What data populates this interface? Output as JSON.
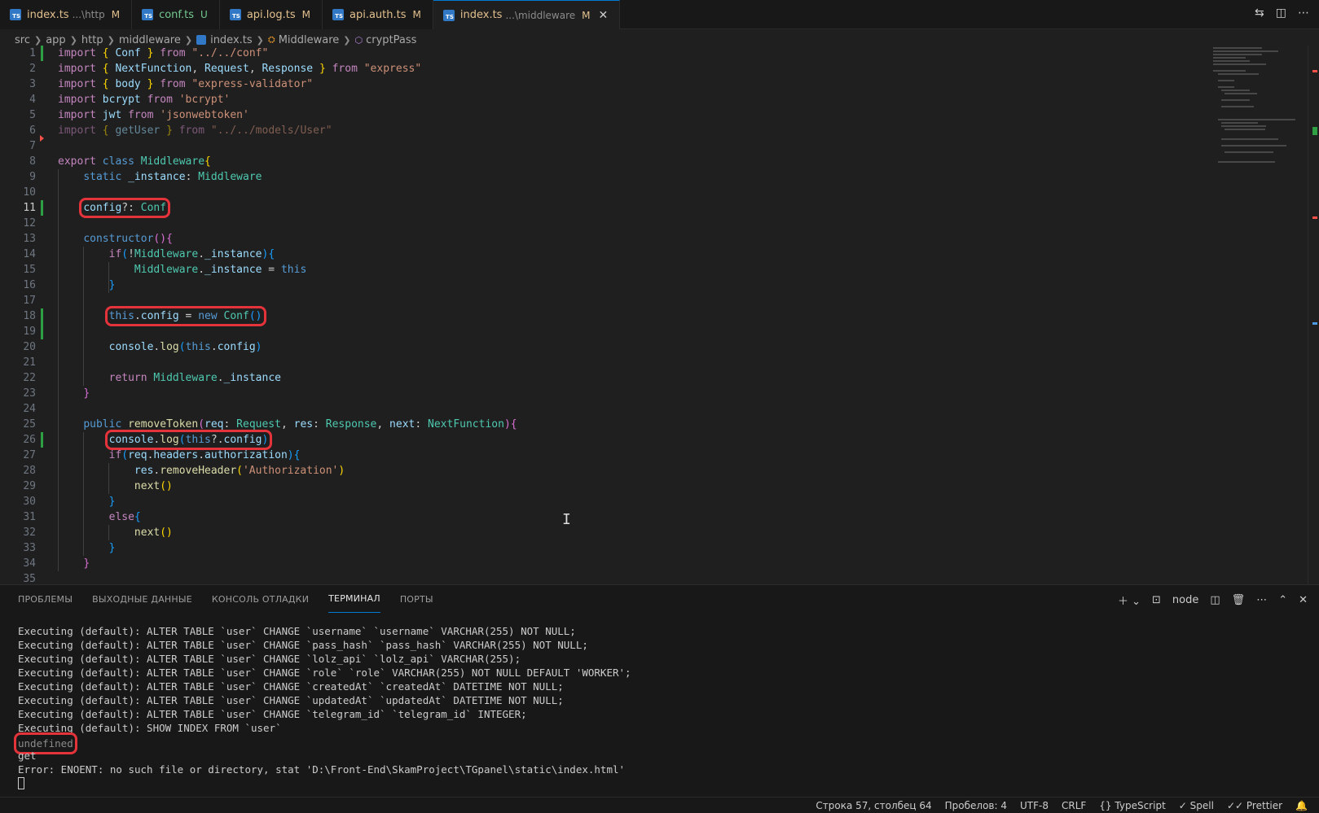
{
  "tabs": [
    {
      "name": "index.ts",
      "path": "...\\http",
      "status": "M"
    },
    {
      "name": "conf.ts",
      "path": "",
      "status": "U"
    },
    {
      "name": "api.log.ts",
      "path": "",
      "status": "M"
    },
    {
      "name": "api.auth.ts",
      "path": "",
      "status": "M"
    },
    {
      "name": "index.ts",
      "path": "...\\middleware",
      "status": "M",
      "close": "✕"
    }
  ],
  "breadcrumb": [
    "src",
    "app",
    "http",
    "middleware",
    "index.ts",
    "Middleware",
    "cryptPass"
  ],
  "editor": {
    "line_numbers": [
      "1",
      "2",
      "3",
      "4",
      "5",
      "6",
      "7",
      "8",
      "9",
      "10",
      "11",
      "12",
      "13",
      "14",
      "15",
      "16",
      "17",
      "18",
      "19",
      "20",
      "21",
      "22",
      "23",
      "24",
      "25",
      "26",
      "27",
      "28",
      "29",
      "30",
      "31",
      "32",
      "33",
      "34",
      "35"
    ]
  },
  "panel": {
    "tabs": [
      "ПРОБЛЕМЫ",
      "ВЫХОДНЫЕ ДАННЫЕ",
      "КОНСОЛЬ ОТЛАДКИ",
      "ТЕРМИНАЛ",
      "ПОРТЫ"
    ],
    "active_tab": "ТЕРМИНАЛ",
    "shell": "node",
    "terminal_lines": [
      "Executing (default): ALTER TABLE `user` CHANGE `username` `username` VARCHAR(255) NOT NULL;",
      "Executing (default): ALTER TABLE `user` CHANGE `pass_hash` `pass_hash` VARCHAR(255) NOT NULL;",
      "Executing (default): ALTER TABLE `user` CHANGE `lolz_api` `lolz_api` VARCHAR(255);",
      "Executing (default): ALTER TABLE `user` CHANGE `role` `role` VARCHAR(255) NOT NULL DEFAULT 'WORKER';",
      "Executing (default): ALTER TABLE `user` CHANGE `createdAt` `createdAt` DATETIME NOT NULL;",
      "Executing (default): ALTER TABLE `user` CHANGE `updatedAt` `updatedAt` DATETIME NOT NULL;",
      "Executing (default): ALTER TABLE `user` CHANGE `telegram_id` `telegram_id` INTEGER;",
      "Executing (default): SHOW INDEX FROM `user`"
    ],
    "undefined_line": "undefined",
    "get_line": "get",
    "error_line": "Error: ENOENT: no such file or directory, stat 'D:\\Front-End\\SkamProject\\TGpanel\\static\\index.html'"
  },
  "status": {
    "position": "Строка 57, столбец 64",
    "spaces": "Пробелов: 4",
    "encoding": "UTF-8",
    "eol": "CRLF",
    "language": "TypeScript",
    "spell": "Spell",
    "prettier": "Prettier"
  }
}
